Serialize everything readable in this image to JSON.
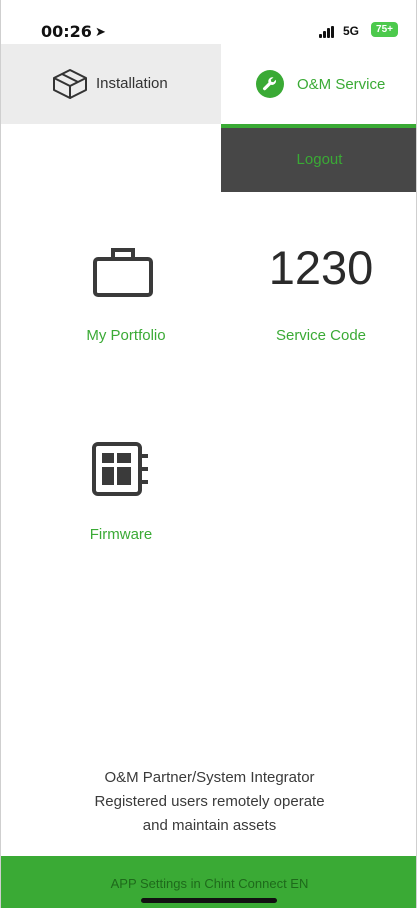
{
  "status_bar": {
    "time": "00:26",
    "network": "5G",
    "battery": "75+"
  },
  "tabs": {
    "installation_label": "Installation",
    "service_label": "O&M Service",
    "active": "O&M Service",
    "accent_color": "#3aaa35"
  },
  "logout_label": "Logout",
  "grid": {
    "portfolio_label": "My Portfolio",
    "service_code_value": "1230",
    "service_code_label": "Service Code",
    "firmware_label": "Firmware"
  },
  "info": {
    "line1": "O&M Partner/System Integrator",
    "line2": "Registered users remotely operate",
    "line3": "and maintain assets"
  },
  "bottom_bar": {
    "text": "APP Settings in Chint Connect EN"
  }
}
